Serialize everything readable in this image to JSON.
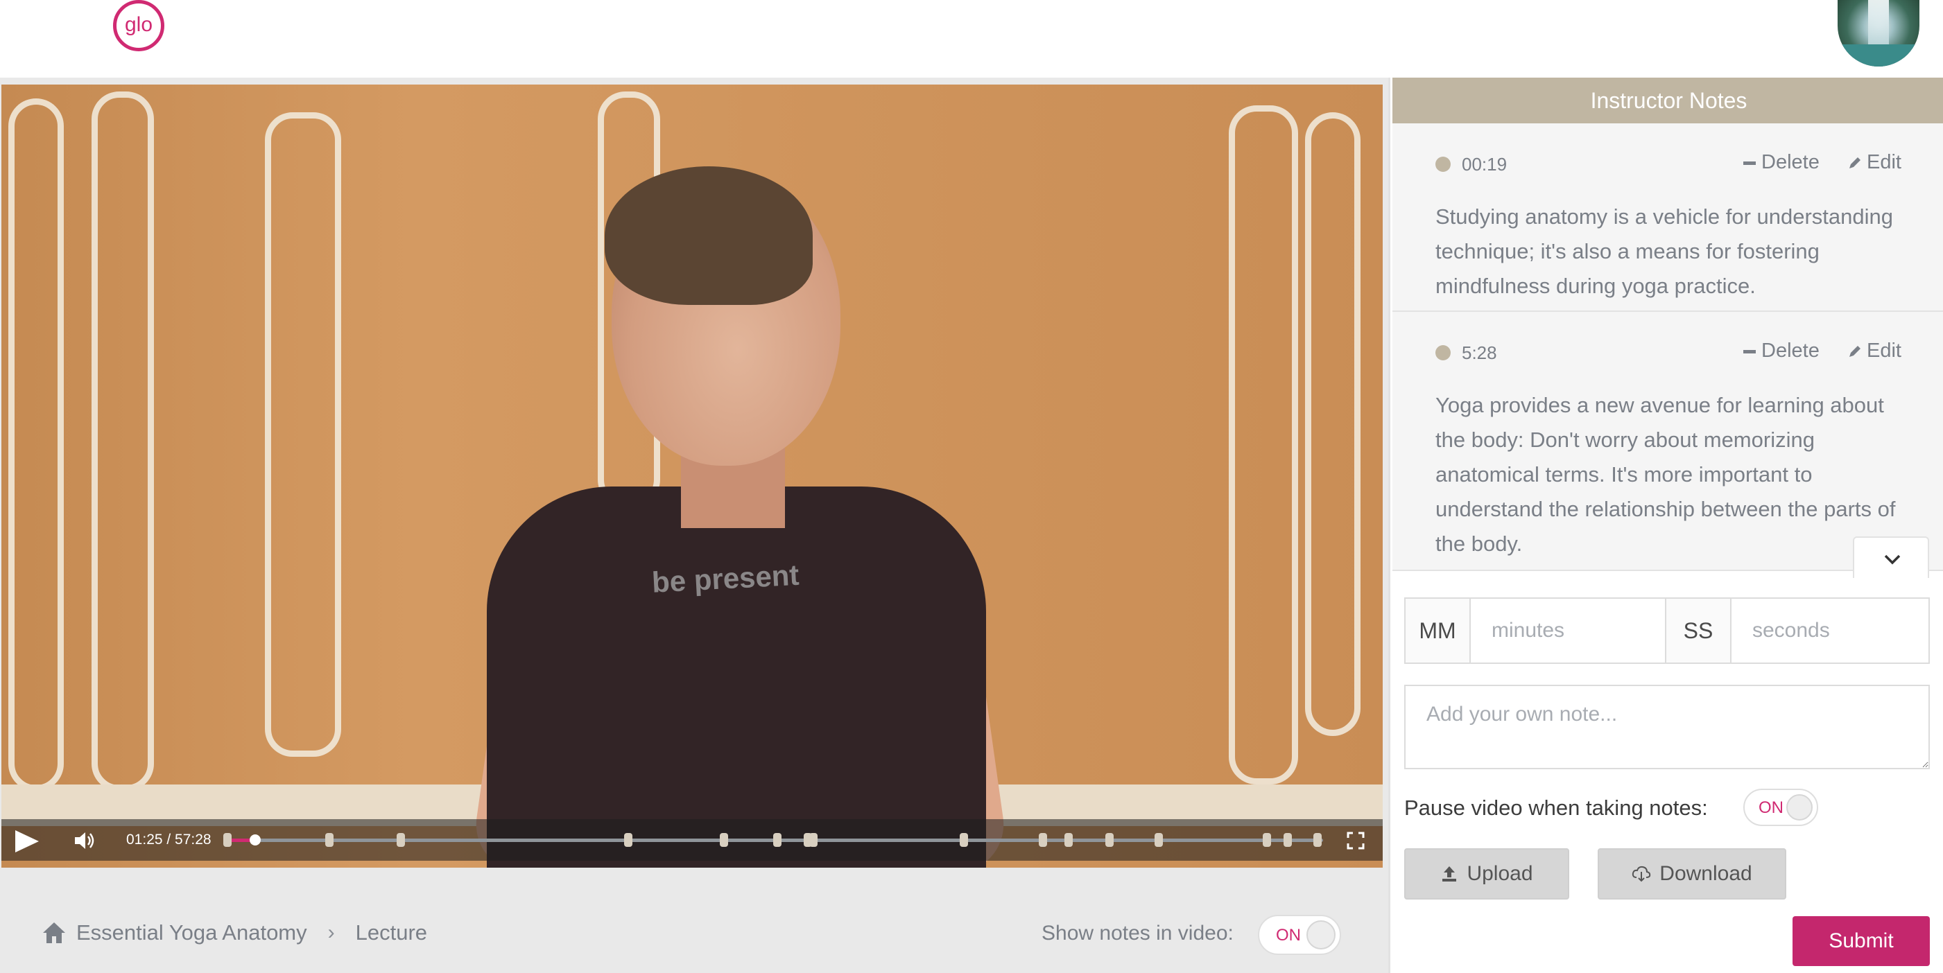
{
  "header": {
    "logo_text": "glo",
    "brand_color": "#d02a72",
    "avatar_icon": "waterfall-avatar"
  },
  "video": {
    "shirt_text": "be present",
    "time_display": "01:25 / 57:28",
    "progress_fraction": 0.025,
    "note_marker_fractions": [
      0.0,
      0.093,
      0.158,
      0.366,
      0.453,
      0.502,
      0.53,
      0.535,
      0.672,
      0.744,
      0.768,
      0.805,
      0.85,
      0.949,
      0.968,
      0.995
    ],
    "icons": {
      "play": "play-icon",
      "volume": "volume-icon",
      "fullscreen": "fullscreen-icon"
    }
  },
  "breadcrumb": {
    "home_icon": "home-icon",
    "course": "Essential Yoga Anatomy",
    "separator": "›",
    "current": "Lecture"
  },
  "show_notes": {
    "label": "Show notes in video:",
    "toggle": "ON"
  },
  "notes_panel": {
    "title": "Instructor Notes",
    "header_color": "#c0b6a2",
    "delete_label": "Delete",
    "edit_label": "Edit",
    "notes": [
      {
        "time": "00:19",
        "text": "Studying anatomy is a vehicle for understanding technique; it's also a means for fostering mindfulness during yoga practice."
      },
      {
        "time": "5:28",
        "text": "Yoga provides a new avenue for learning about the body: Don't worry about memorizing anatomical terms. It's more important to understand the relationship between the parts of the body."
      }
    ]
  },
  "note_form": {
    "minutes_unit": "MM",
    "minutes_placeholder": "minutes",
    "seconds_unit": "SS",
    "seconds_placeholder": "seconds",
    "note_placeholder": "Add your own note...",
    "pause_label": "Pause video when taking notes:",
    "pause_toggle": "ON",
    "upload_label": "Upload",
    "download_label": "Download",
    "submit_label": "Submit",
    "submit_color": "#c4276d"
  }
}
